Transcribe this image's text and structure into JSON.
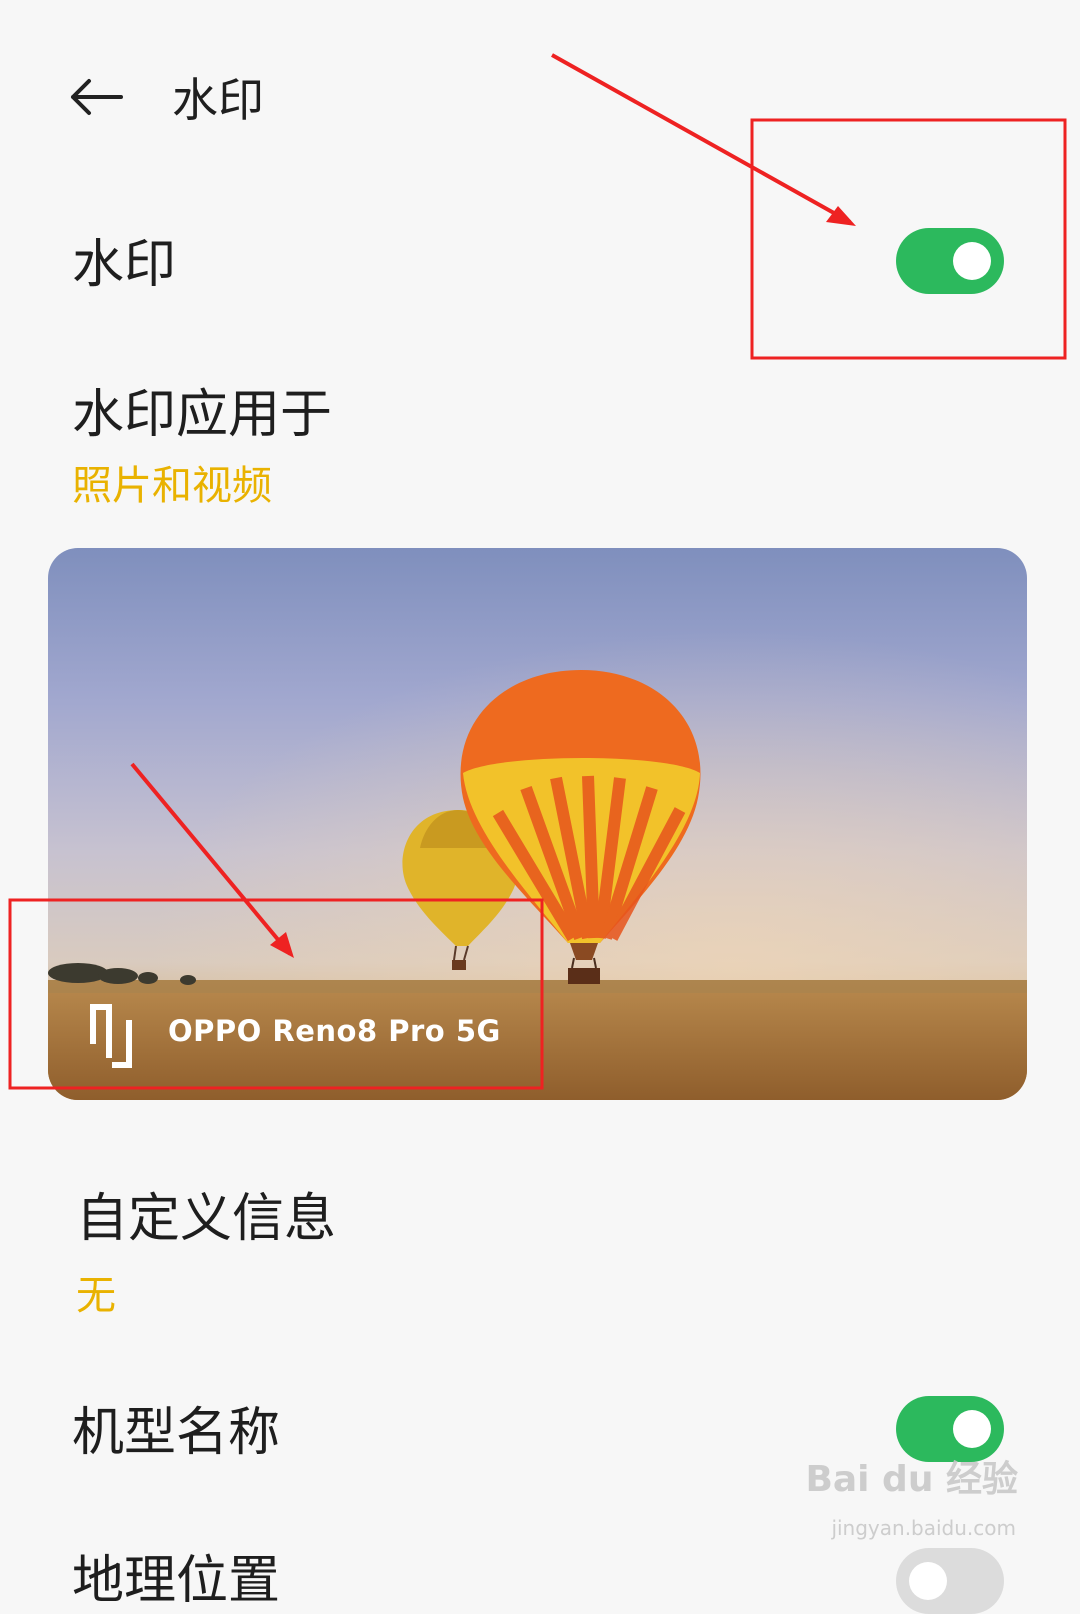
{
  "header": {
    "title": "水印"
  },
  "rows": {
    "watermark": {
      "label": "水印",
      "toggle_on": true
    },
    "apply_to": {
      "label": "水印应用于",
      "value": "照片和视频"
    },
    "custom_info": {
      "label": "自定义信息",
      "value": "无"
    },
    "model_name": {
      "label": "机型名称",
      "toggle_on": true
    },
    "location": {
      "label": "地理位置",
      "toggle_on": false
    }
  },
  "preview": {
    "watermark_text": "OPPO Reno8 Pro 5G"
  },
  "site_watermark": {
    "brand": "Bai du 经验",
    "url": "jingyan.baidu.com"
  },
  "colors": {
    "accent_toggle": "#2cb95d",
    "accent_subtext": "#e9b200",
    "annotation": "#ee2222"
  }
}
